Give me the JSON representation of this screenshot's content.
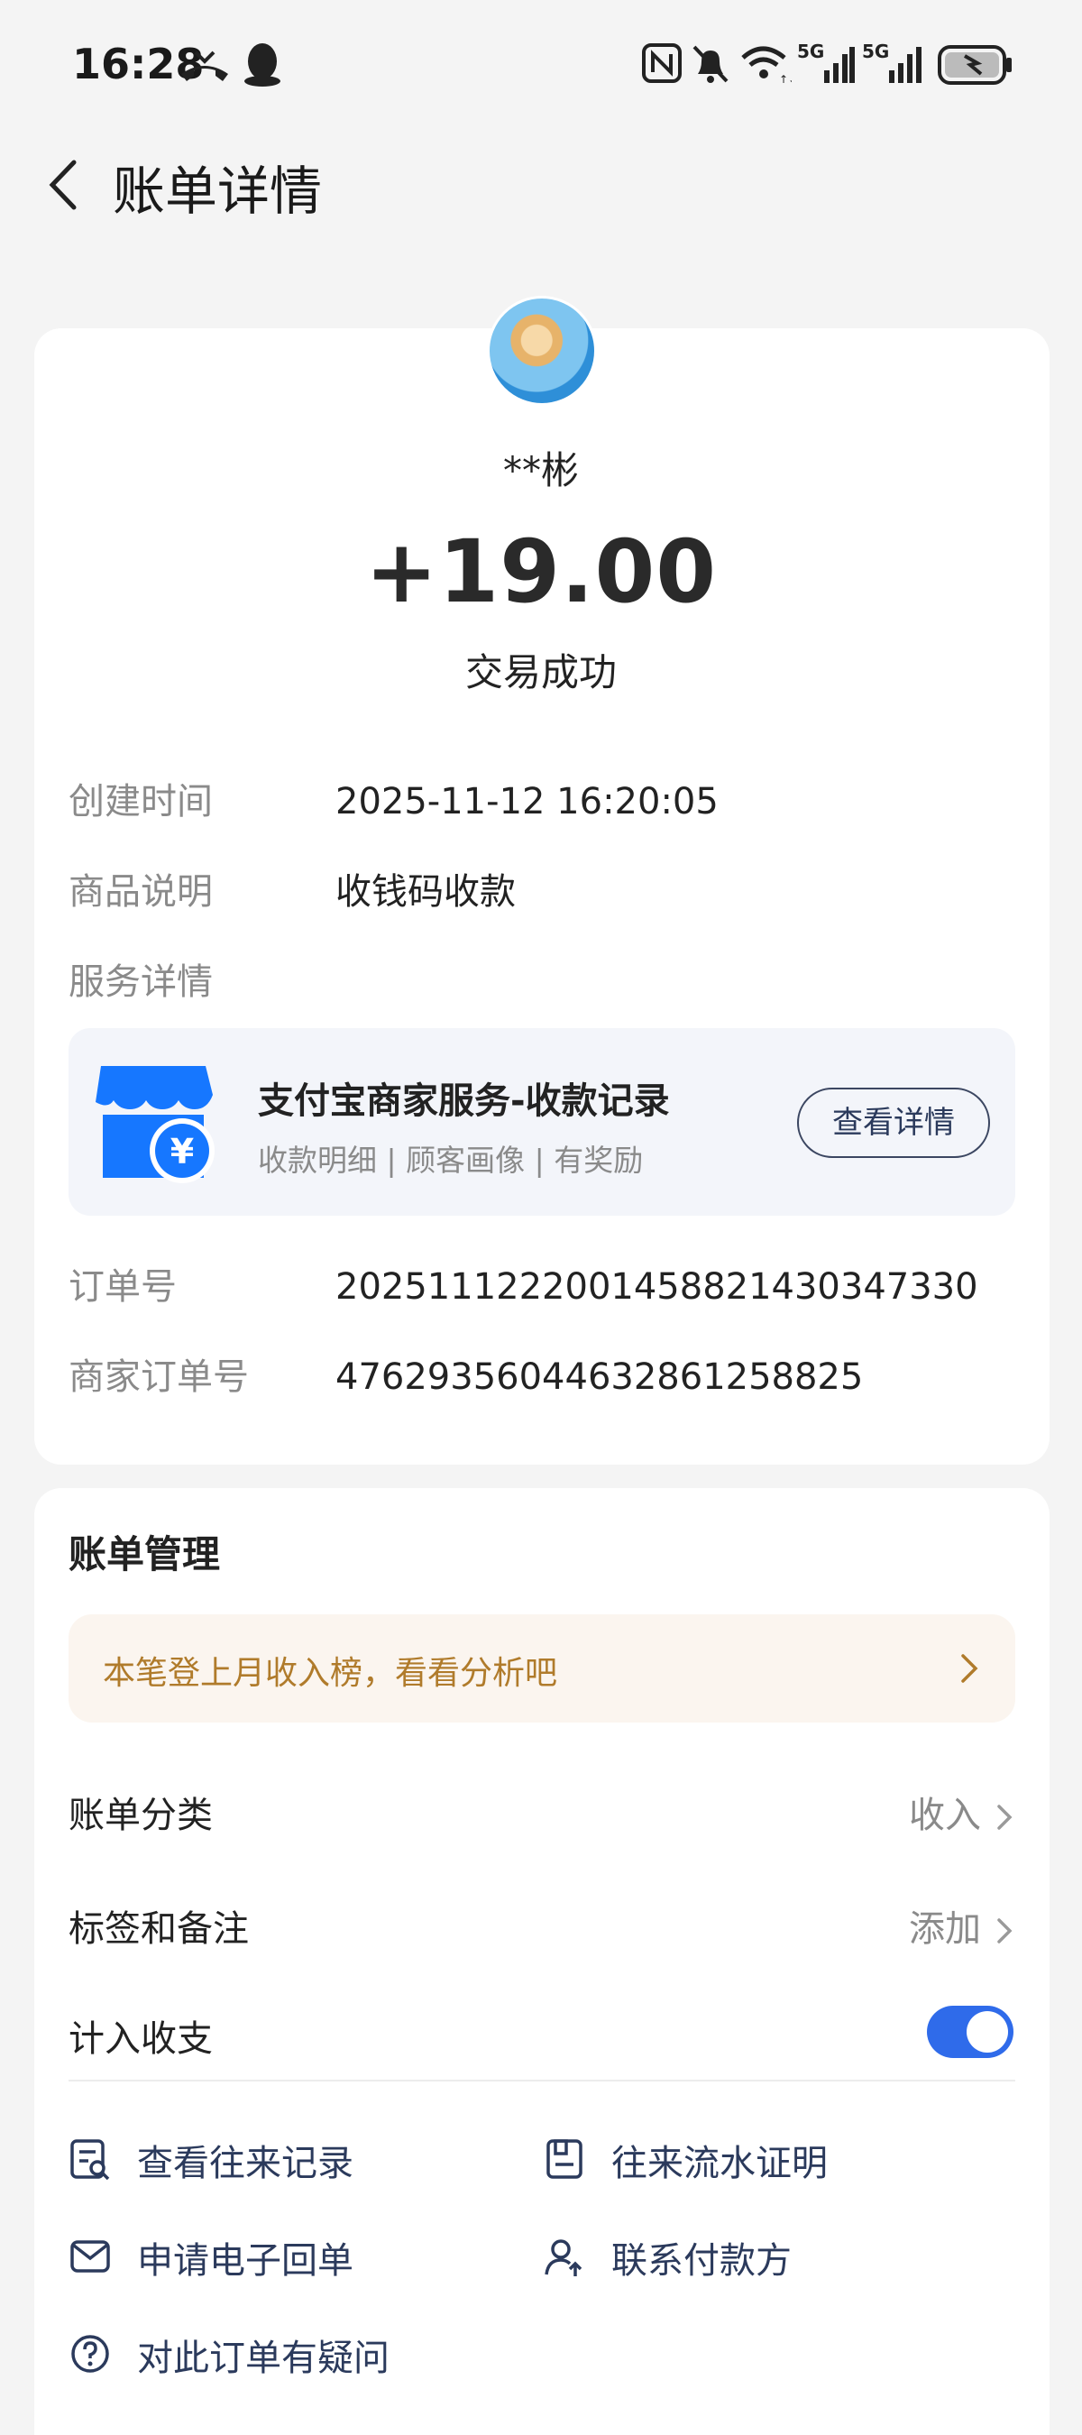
{
  "status_bar": {
    "time": "16:28",
    "network_label": "5G",
    "battery_icon": "battery-charging-icon"
  },
  "nav": {
    "title": "账单详情"
  },
  "bill": {
    "payer": "**彬",
    "amount": "+19.00",
    "state": "交易成功",
    "created_label": "创建时间",
    "created_value": "2025-11-12 16:20:05",
    "goods_label": "商品说明",
    "goods_value": "收钱码收款",
    "service_label": "服务详情",
    "service": {
      "name": "支付宝商家服务-收款记录",
      "desc": "收款明细 | 顾客画像 | 有奖励",
      "button": "查看详情"
    },
    "order_label": "订单号",
    "order_value": "2025111222001458821430347330",
    "merchant_order_label": "商家订单号",
    "merchant_order_value": "47629356044632861258825"
  },
  "manage": {
    "title": "账单管理",
    "promo": "本笔登上月收入榜，看看分析吧",
    "category_label": "账单分类",
    "category_value": "收入",
    "tag_label": "标签和备注",
    "tag_value": "添加",
    "include_label": "计入收支",
    "include_on": true,
    "actions": [
      "查看往来记录",
      "往来流水证明",
      "申请电子回单",
      "联系付款方",
      "对此订单有疑问"
    ]
  },
  "colors": {
    "accent": "#2f6bea",
    "promo_text": "#b07b2b",
    "promo_bg": "#fbf5ef"
  }
}
